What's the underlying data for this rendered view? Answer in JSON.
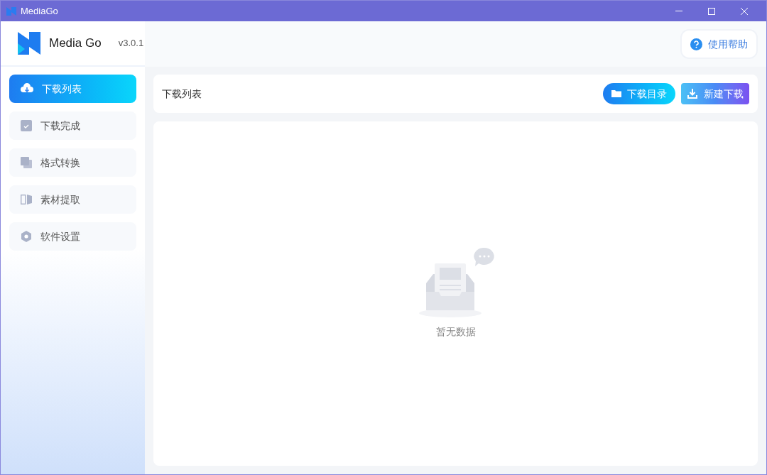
{
  "window": {
    "title": "MediaGo"
  },
  "header": {
    "app_name": "Media Go",
    "version": "v3.0.1",
    "help_button": "使用帮助"
  },
  "sidebar": {
    "items": [
      {
        "label": "下载列表",
        "kind": "download",
        "selected": true
      },
      {
        "label": "下载完成",
        "kind": "done",
        "selected": false
      },
      {
        "label": "格式转换",
        "kind": "convert",
        "selected": false
      },
      {
        "label": "素材提取",
        "kind": "extract",
        "selected": false
      },
      {
        "label": "软件设置",
        "kind": "settings",
        "selected": false
      }
    ]
  },
  "toolbar": {
    "title": "下载列表",
    "buttons": [
      {
        "label": "下载目录",
        "kind": "folder"
      },
      {
        "label": "新建下载",
        "kind": "new"
      }
    ]
  },
  "empty_state": {
    "text": "暂无数据"
  }
}
